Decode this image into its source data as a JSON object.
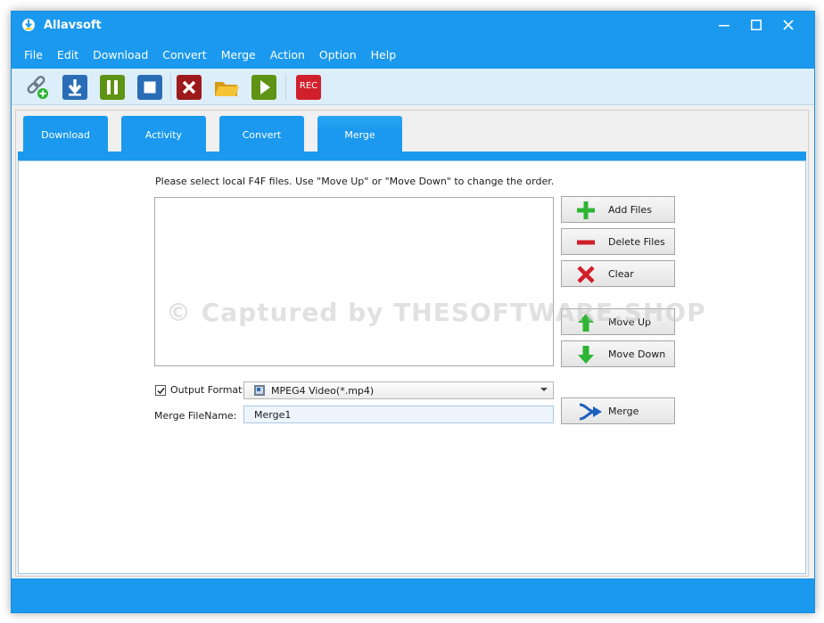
{
  "window": {
    "title": "Allavsoft"
  },
  "menu": [
    "File",
    "Edit",
    "Download",
    "Convert",
    "Merge",
    "Action",
    "Option",
    "Help"
  ],
  "toolbar": {
    "icons": [
      "add-url-icon",
      "download-icon",
      "pause-icon",
      "stop-icon",
      "cancel-icon",
      "open-folder-icon",
      "play-icon",
      "record-icon"
    ],
    "rec_label": "REC"
  },
  "tabs": [
    {
      "label": "Download",
      "active": false
    },
    {
      "label": "Activity",
      "active": false
    },
    {
      "label": "Convert",
      "active": false
    },
    {
      "label": "Merge",
      "active": true
    }
  ],
  "merge": {
    "instruction": "Please select local F4F files. Use \"Move Up\" or \"Move Down\" to change the order.",
    "buttons": {
      "add_files": "Add Files",
      "delete_files": "Delete Files",
      "clear": "Clear",
      "move_up": "Move Up",
      "move_down": "Move Down",
      "merge": "Merge"
    },
    "output_format_label": "Output Format:",
    "output_format_checked": true,
    "output_format_value": "MPEG4 Video(*.mp4)",
    "filename_label": "Merge FileName:",
    "filename_value": "Merge1"
  },
  "watermark": "© Captured by THESOFTWARE.SHOP",
  "colors": {
    "accent": "#1a99ee",
    "green": "#2db534",
    "red": "#d11f2b"
  }
}
